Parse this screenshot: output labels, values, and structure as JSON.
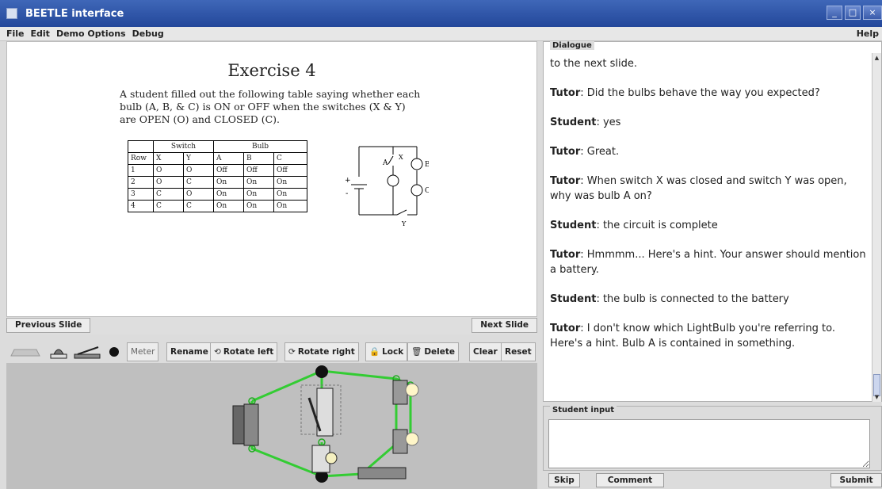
{
  "window": {
    "title": "BEETLE interface"
  },
  "menu": [
    "File",
    "Edit",
    "Demo Options",
    "Debug"
  ],
  "menu_help": "Help",
  "slide": {
    "title": "Exercise 4",
    "text": "A student filled out the following table saying whether each bulb (A, B, & C) is ON or OFF when the switches (X & Y) are OPEN (O) and CLOSED (C).",
    "table": {
      "group_headers": [
        "Switch",
        "Bulb"
      ],
      "columns": [
        "Row",
        "X",
        "Y",
        "A",
        "B",
        "C"
      ],
      "rows": [
        [
          "1",
          "O",
          "O",
          "Off",
          "Off",
          "Off"
        ],
        [
          "2",
          "O",
          "C",
          "On",
          "On",
          "On"
        ],
        [
          "3",
          "C",
          "O",
          "On",
          "On",
          "On"
        ],
        [
          "4",
          "C",
          "C",
          "On",
          "On",
          "On"
        ]
      ]
    },
    "circuit_labels": {
      "a": "A",
      "b": "B",
      "c": "C",
      "x": "X",
      "y": "Y",
      "plus": "+",
      "minus": "-"
    }
  },
  "nav": {
    "prev": "Previous Slide",
    "next": "Next Slide"
  },
  "toolbar": {
    "meter": "Meter",
    "rename": "Rename",
    "rotate_left": "Rotate left",
    "rotate_right": "Rotate right",
    "lock": "Lock",
    "delete": "Delete",
    "clear": "Clear",
    "reset": "Reset"
  },
  "dialogue": {
    "label": "Dialogue",
    "messages": [
      {
        "speaker": "",
        "text": "to the next slide."
      },
      {
        "speaker": "Tutor",
        "text": ": Did the bulbs behave the way you expected?"
      },
      {
        "speaker": "Student",
        "text": ": yes"
      },
      {
        "speaker": "Tutor",
        "text": ": Great."
      },
      {
        "speaker": "Tutor",
        "text": ": When switch X was closed and switch Y was open, why was bulb A on?"
      },
      {
        "speaker": "Student",
        "text": ": the circuit is complete"
      },
      {
        "speaker": "Tutor",
        "text": ": Hmmmm... Here's a hint. Your answer should mention a battery."
      },
      {
        "speaker": "Student",
        "text": ": the bulb is connected to the battery"
      },
      {
        "speaker": "Tutor",
        "text": ": I don't know which LightBulb you're referring to. Here's a hint. Bulb A is contained in something."
      }
    ]
  },
  "student_input": {
    "label": "Student input",
    "value": ""
  },
  "buttons": {
    "skip": "Skip",
    "comment": "Comment",
    "submit": "Submit"
  },
  "colors": {
    "titlebar": "#2e53a6",
    "wire": "#33cc33",
    "panel": "#dcdcdc"
  }
}
